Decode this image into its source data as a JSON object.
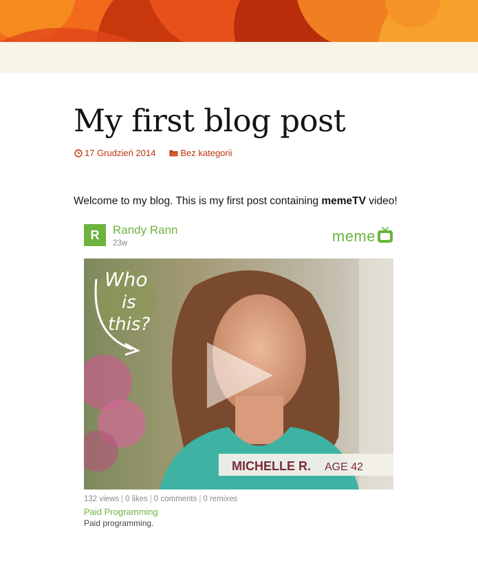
{
  "post": {
    "title": "My first blog post",
    "date": "17 Grudzień 2014",
    "category": "Bez kategorii",
    "body_prefix": "Welcome to my blog. This is my first post containing ",
    "body_bold": "memeTV",
    "body_suffix": " video!"
  },
  "embed": {
    "avatar_letter": "R",
    "author": "Randy Rann",
    "age": "23w",
    "logo_text": "meme",
    "overlay_handwriting": [
      "Who",
      "is",
      "this?"
    ],
    "lower_third_name": "MICHELLE R.",
    "lower_third_age": "AGE 42",
    "stats": {
      "views": "132 views",
      "likes": "0 likes",
      "comments": "0 comments",
      "remixes": "0 remixes"
    },
    "video_title": "Paid Programming",
    "video_description": "Paid programming."
  },
  "colors": {
    "accent_link": "#bc360a",
    "meme_green": "#6cb33f",
    "header_band": "#f7f4e6"
  },
  "icons": {
    "date": "clock-icon",
    "category": "folder-icon",
    "play": "play-icon",
    "logo": "tv-icon"
  }
}
